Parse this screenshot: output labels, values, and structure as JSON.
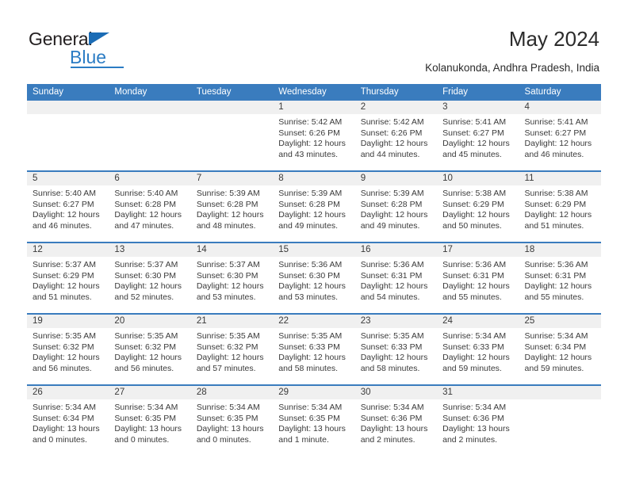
{
  "logo": {
    "word_one": "General",
    "word_two": "Blue",
    "triangle_icon": "triangle-icon"
  },
  "header": {
    "title": "May 2024",
    "subtitle": "Kolanukonda, Andhra Pradesh, India"
  },
  "calendar": {
    "accent_color": "#3a7cbe",
    "daynum_band_color": "#f0f0f0",
    "weekday_headers": [
      "Sunday",
      "Monday",
      "Tuesday",
      "Wednesday",
      "Thursday",
      "Friday",
      "Saturday"
    ],
    "labels": {
      "sunrise": "Sunrise:",
      "sunset": "Sunset:",
      "daylight": "Daylight:"
    },
    "weeks": [
      [
        {
          "day": "",
          "empty": true
        },
        {
          "day": "",
          "empty": true
        },
        {
          "day": "",
          "empty": true
        },
        {
          "day": "1",
          "sunrise": "Sunrise: 5:42 AM",
          "sunset": "Sunset: 6:26 PM",
          "daylight": "Daylight: 12 hours and 43 minutes."
        },
        {
          "day": "2",
          "sunrise": "Sunrise: 5:42 AM",
          "sunset": "Sunset: 6:26 PM",
          "daylight": "Daylight: 12 hours and 44 minutes."
        },
        {
          "day": "3",
          "sunrise": "Sunrise: 5:41 AM",
          "sunset": "Sunset: 6:27 PM",
          "daylight": "Daylight: 12 hours and 45 minutes."
        },
        {
          "day": "4",
          "sunrise": "Sunrise: 5:41 AM",
          "sunset": "Sunset: 6:27 PM",
          "daylight": "Daylight: 12 hours and 46 minutes."
        }
      ],
      [
        {
          "day": "5",
          "sunrise": "Sunrise: 5:40 AM",
          "sunset": "Sunset: 6:27 PM",
          "daylight": "Daylight: 12 hours and 46 minutes."
        },
        {
          "day": "6",
          "sunrise": "Sunrise: 5:40 AM",
          "sunset": "Sunset: 6:28 PM",
          "daylight": "Daylight: 12 hours and 47 minutes."
        },
        {
          "day": "7",
          "sunrise": "Sunrise: 5:39 AM",
          "sunset": "Sunset: 6:28 PM",
          "daylight": "Daylight: 12 hours and 48 minutes."
        },
        {
          "day": "8",
          "sunrise": "Sunrise: 5:39 AM",
          "sunset": "Sunset: 6:28 PM",
          "daylight": "Daylight: 12 hours and 49 minutes."
        },
        {
          "day": "9",
          "sunrise": "Sunrise: 5:39 AM",
          "sunset": "Sunset: 6:28 PM",
          "daylight": "Daylight: 12 hours and 49 minutes."
        },
        {
          "day": "10",
          "sunrise": "Sunrise: 5:38 AM",
          "sunset": "Sunset: 6:29 PM",
          "daylight": "Daylight: 12 hours and 50 minutes."
        },
        {
          "day": "11",
          "sunrise": "Sunrise: 5:38 AM",
          "sunset": "Sunset: 6:29 PM",
          "daylight": "Daylight: 12 hours and 51 minutes."
        }
      ],
      [
        {
          "day": "12",
          "sunrise": "Sunrise: 5:37 AM",
          "sunset": "Sunset: 6:29 PM",
          "daylight": "Daylight: 12 hours and 51 minutes."
        },
        {
          "day": "13",
          "sunrise": "Sunrise: 5:37 AM",
          "sunset": "Sunset: 6:30 PM",
          "daylight": "Daylight: 12 hours and 52 minutes."
        },
        {
          "day": "14",
          "sunrise": "Sunrise: 5:37 AM",
          "sunset": "Sunset: 6:30 PM",
          "daylight": "Daylight: 12 hours and 53 minutes."
        },
        {
          "day": "15",
          "sunrise": "Sunrise: 5:36 AM",
          "sunset": "Sunset: 6:30 PM",
          "daylight": "Daylight: 12 hours and 53 minutes."
        },
        {
          "day": "16",
          "sunrise": "Sunrise: 5:36 AM",
          "sunset": "Sunset: 6:31 PM",
          "daylight": "Daylight: 12 hours and 54 minutes."
        },
        {
          "day": "17",
          "sunrise": "Sunrise: 5:36 AM",
          "sunset": "Sunset: 6:31 PM",
          "daylight": "Daylight: 12 hours and 55 minutes."
        },
        {
          "day": "18",
          "sunrise": "Sunrise: 5:36 AM",
          "sunset": "Sunset: 6:31 PM",
          "daylight": "Daylight: 12 hours and 55 minutes."
        }
      ],
      [
        {
          "day": "19",
          "sunrise": "Sunrise: 5:35 AM",
          "sunset": "Sunset: 6:32 PM",
          "daylight": "Daylight: 12 hours and 56 minutes."
        },
        {
          "day": "20",
          "sunrise": "Sunrise: 5:35 AM",
          "sunset": "Sunset: 6:32 PM",
          "daylight": "Daylight: 12 hours and 56 minutes."
        },
        {
          "day": "21",
          "sunrise": "Sunrise: 5:35 AM",
          "sunset": "Sunset: 6:32 PM",
          "daylight": "Daylight: 12 hours and 57 minutes."
        },
        {
          "day": "22",
          "sunrise": "Sunrise: 5:35 AM",
          "sunset": "Sunset: 6:33 PM",
          "daylight": "Daylight: 12 hours and 58 minutes."
        },
        {
          "day": "23",
          "sunrise": "Sunrise: 5:35 AM",
          "sunset": "Sunset: 6:33 PM",
          "daylight": "Daylight: 12 hours and 58 minutes."
        },
        {
          "day": "24",
          "sunrise": "Sunrise: 5:34 AM",
          "sunset": "Sunset: 6:33 PM",
          "daylight": "Daylight: 12 hours and 59 minutes."
        },
        {
          "day": "25",
          "sunrise": "Sunrise: 5:34 AM",
          "sunset": "Sunset: 6:34 PM",
          "daylight": "Daylight: 12 hours and 59 minutes."
        }
      ],
      [
        {
          "day": "26",
          "sunrise": "Sunrise: 5:34 AM",
          "sunset": "Sunset: 6:34 PM",
          "daylight": "Daylight: 13 hours and 0 minutes."
        },
        {
          "day": "27",
          "sunrise": "Sunrise: 5:34 AM",
          "sunset": "Sunset: 6:35 PM",
          "daylight": "Daylight: 13 hours and 0 minutes."
        },
        {
          "day": "28",
          "sunrise": "Sunrise: 5:34 AM",
          "sunset": "Sunset: 6:35 PM",
          "daylight": "Daylight: 13 hours and 0 minutes."
        },
        {
          "day": "29",
          "sunrise": "Sunrise: 5:34 AM",
          "sunset": "Sunset: 6:35 PM",
          "daylight": "Daylight: 13 hours and 1 minute."
        },
        {
          "day": "30",
          "sunrise": "Sunrise: 5:34 AM",
          "sunset": "Sunset: 6:36 PM",
          "daylight": "Daylight: 13 hours and 2 minutes."
        },
        {
          "day": "31",
          "sunrise": "Sunrise: 5:34 AM",
          "sunset": "Sunset: 6:36 PM",
          "daylight": "Daylight: 13 hours and 2 minutes."
        },
        {
          "day": "",
          "empty": true
        }
      ]
    ]
  }
}
